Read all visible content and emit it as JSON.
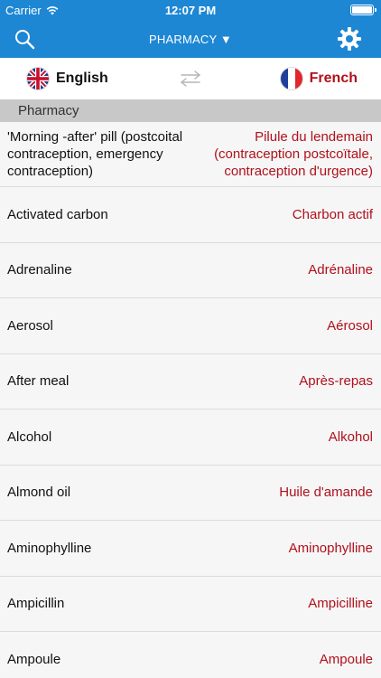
{
  "status_bar": {
    "carrier": "Carrier",
    "time": "12:07 PM"
  },
  "nav": {
    "title": "PHARMACY ▼",
    "search_icon": "search-icon",
    "settings_icon": "gear-icon"
  },
  "languages": {
    "source": "English",
    "target": "French",
    "source_flag": "uk-flag-icon",
    "target_flag": "france-flag-icon",
    "swap_icon": "swap-arrows-icon"
  },
  "section": {
    "title": "Pharmacy"
  },
  "entries": [
    {
      "en": "'Morning -after' pill (postcoital contraception, emergency contraception)",
      "fr": "Pilule du lendemain (contraception postcoïtale, contraception d'urgence)"
    },
    {
      "en": "Activated carbon",
      "fr": "Charbon actif"
    },
    {
      "en": "Adrenaline",
      "fr": "Adrénaline"
    },
    {
      "en": "Aerosol",
      "fr": "Aérosol"
    },
    {
      "en": "After meal",
      "fr": "Après-repas"
    },
    {
      "en": "Alcohol",
      "fr": "Alkohol"
    },
    {
      "en": "Almond oil",
      "fr": "Huile d'amande"
    },
    {
      "en": "Aminophylline",
      "fr": "Aminophylline"
    },
    {
      "en": "Ampicillin",
      "fr": "Ampicilline"
    },
    {
      "en": "Ampoule",
      "fr": "Ampoule"
    }
  ],
  "colors": {
    "header_blue": "#1d87d4",
    "french_red": "#b0101c",
    "section_gray": "#c8c8c8"
  }
}
